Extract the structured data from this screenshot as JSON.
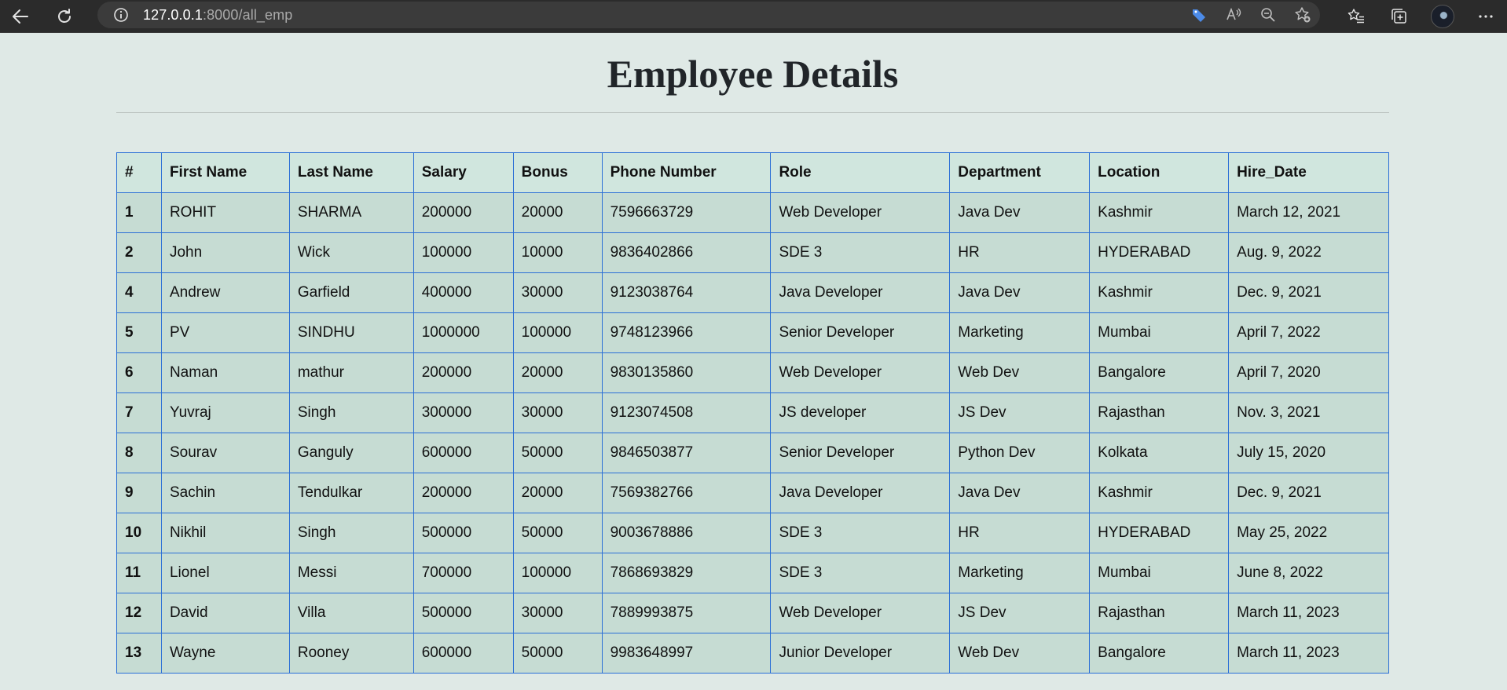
{
  "browser": {
    "url_host": "127.0.0.1",
    "url_rest": ":8000/all_emp"
  },
  "page": {
    "title": "Employee Details"
  },
  "table": {
    "headers": [
      "#",
      "First Name",
      "Last Name",
      "Salary",
      "Bonus",
      "Phone Number",
      "Role",
      "Department",
      "Location",
      "Hire_Date"
    ],
    "rows": [
      [
        "1",
        "ROHIT",
        "SHARMA",
        "200000",
        "20000",
        "7596663729",
        "Web Developer",
        "Java Dev",
        "Kashmir",
        "March 12, 2021"
      ],
      [
        "2",
        "John",
        "Wick",
        "100000",
        "10000",
        "9836402866",
        "SDE 3",
        "HR",
        "HYDERABAD",
        "Aug. 9, 2022"
      ],
      [
        "4",
        "Andrew",
        "Garfield",
        "400000",
        "30000",
        "9123038764",
        "Java Developer",
        "Java Dev",
        "Kashmir",
        "Dec. 9, 2021"
      ],
      [
        "5",
        "PV",
        "SINDHU",
        "1000000",
        "100000",
        "9748123966",
        "Senior Developer",
        "Marketing",
        "Mumbai",
        "April 7, 2022"
      ],
      [
        "6",
        "Naman",
        "mathur",
        "200000",
        "20000",
        "9830135860",
        "Web Developer",
        "Web Dev",
        "Bangalore",
        "April 7, 2020"
      ],
      [
        "7",
        "Yuvraj",
        "Singh",
        "300000",
        "30000",
        "9123074508",
        "JS developer",
        "JS Dev",
        "Rajasthan",
        "Nov. 3, 2021"
      ],
      [
        "8",
        "Sourav",
        "Ganguly",
        "600000",
        "50000",
        "9846503877",
        "Senior Developer",
        "Python Dev",
        "Kolkata",
        "July 15, 2020"
      ],
      [
        "9",
        "Sachin",
        "Tendulkar",
        "200000",
        "20000",
        "7569382766",
        "Java Developer",
        "Java Dev",
        "Kashmir",
        "Dec. 9, 2021"
      ],
      [
        "10",
        "Nikhil",
        "Singh",
        "500000",
        "50000",
        "9003678886",
        "SDE 3",
        "HR",
        "HYDERABAD",
        "May 25, 2022"
      ],
      [
        "11",
        "Lionel",
        "Messi",
        "700000",
        "100000",
        "7868693829",
        "SDE 3",
        "Marketing",
        "Mumbai",
        "June 8, 2022"
      ],
      [
        "12",
        "David",
        "Villa",
        "500000",
        "30000",
        "7889993875",
        "Web Developer",
        "JS Dev",
        "Rajasthan",
        "March 11, 2023"
      ],
      [
        "13",
        "Wayne",
        "Rooney",
        "600000",
        "50000",
        "9983648997",
        "Junior Developer",
        "Web Dev",
        "Bangalore",
        "March 11, 2023"
      ]
    ]
  },
  "colors": {
    "toolbar_bg": "#2b2b2b",
    "page_bg": "#dfe9e6",
    "table_border": "#2b6fd6",
    "header_bg": "#d0e6de",
    "cell_bg": "#c6dcd3"
  }
}
